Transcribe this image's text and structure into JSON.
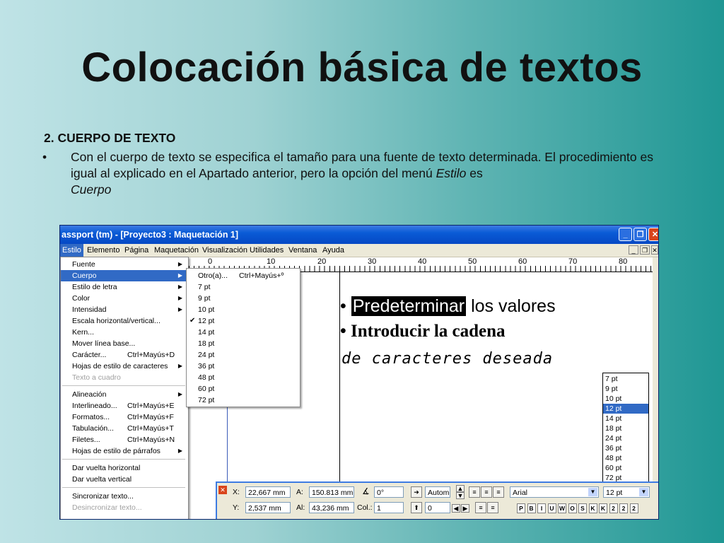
{
  "slide": {
    "title": "Colocación básica de textos",
    "heading": "2. CUERPO DE TEXTO",
    "bullet_char": "•",
    "bullet_text": "Con el cuerpo de texto se especifica el tamaño para una fuente de texto determinada. El procedimiento es igual al explicado en el Apartado anterior, pero la opción del menú ",
    "bullet_italic1": "Estilo",
    "bullet_mid": " es ",
    "bullet_italic2": "Cuerpo"
  },
  "window": {
    "title": "assport (tm) - [Proyecto3 : Maquetación 1]",
    "menu": [
      "Estilo",
      "Elemento",
      "Página",
      "Maquetación",
      "Visualización",
      "Utilidades",
      "Ventana",
      "Ayuda"
    ],
    "active_menu": "Estilo"
  },
  "ruler": {
    "labels": [
      "0",
      "10",
      "20",
      "30",
      "40",
      "50",
      "60",
      "70",
      "80"
    ]
  },
  "style_menu": {
    "items": [
      {
        "label": "Fuente",
        "shortcut": "",
        "sub": true
      },
      {
        "label": "Cuerpo",
        "shortcut": "",
        "sub": true,
        "selected": true
      },
      {
        "label": "Estilo de letra",
        "shortcut": "",
        "sub": true
      },
      {
        "label": "Color",
        "shortcut": "",
        "sub": true
      },
      {
        "label": "Intensidad",
        "shortcut": "",
        "sub": true
      },
      {
        "label": "Escala horizontal/vertical...",
        "shortcut": ""
      },
      {
        "label": "Kern...",
        "shortcut": ""
      },
      {
        "label": "Mover línea base...",
        "shortcut": ""
      },
      {
        "label": "Carácter...",
        "shortcut": "Ctrl+Mayús+D"
      },
      {
        "label": "Hojas de estilo de caracteres",
        "shortcut": "",
        "sub": true
      },
      {
        "label": "Texto a cuadro",
        "shortcut": "",
        "disabled": true
      },
      {
        "sep": true
      },
      {
        "label": "Alineación",
        "shortcut": "",
        "sub": true
      },
      {
        "label": "Interlineado...",
        "shortcut": "Ctrl+Mayús+E"
      },
      {
        "label": "Formatos...",
        "shortcut": "Ctrl+Mayús+F"
      },
      {
        "label": "Tabulación...",
        "shortcut": "Ctrl+Mayús+T"
      },
      {
        "label": "Filetes...",
        "shortcut": "Ctrl+Mayús+N"
      },
      {
        "label": "Hojas de estilo de párrafos",
        "shortcut": "",
        "sub": true
      },
      {
        "sep": true
      },
      {
        "label": "Dar vuelta horizontal",
        "shortcut": ""
      },
      {
        "label": "Dar vuelta vertical",
        "shortcut": ""
      },
      {
        "sep": true
      },
      {
        "label": "Sincronizar texto...",
        "shortcut": ""
      },
      {
        "label": "Desincronizar texto...",
        "shortcut": "",
        "disabled": true
      }
    ]
  },
  "size_menu": {
    "items": [
      {
        "label": "Otro(a)...",
        "shortcut": "Ctrl+Mayús+º"
      },
      {
        "label": "7 pt"
      },
      {
        "label": "9 pt"
      },
      {
        "label": "10 pt"
      },
      {
        "label": "12 pt",
        "checked": true
      },
      {
        "label": "14 pt"
      },
      {
        "label": "18 pt"
      },
      {
        "label": "24 pt"
      },
      {
        "label": "36 pt"
      },
      {
        "label": "48 pt"
      },
      {
        "label": "60 pt"
      },
      {
        "label": "72 pt"
      }
    ],
    "check_mark": "✔"
  },
  "canvas": {
    "bullet": "•",
    "line1_highlight": "Predeterminar",
    "line1_rest": " los valores",
    "line2": "Introducir la cadena",
    "line3": "de caracteres deseada"
  },
  "size_list": {
    "options": [
      "7 pt",
      "9 pt",
      "10 pt",
      "12 pt",
      "14 pt",
      "18 pt",
      "24 pt",
      "36 pt",
      "48 pt",
      "60 pt",
      "72 pt"
    ],
    "selected": "12 pt"
  },
  "palette": {
    "x_label": "X:",
    "x_value": "22,667 mm",
    "y_label": "Y:",
    "y_value": "2,537 mm",
    "a_label": "A:",
    "a_value": "150.813 mm",
    "al_label": "Al:",
    "al_value": "43,236 mm",
    "angle_value": "0°",
    "col_label": "Col.:",
    "col_value": "1",
    "leading_value": "Autom",
    "tracking_value": "0",
    "font_value": "Arial",
    "size_value": "12 pt",
    "style_buttons": [
      "P",
      "B",
      "I",
      "U",
      "W",
      "O",
      "S",
      "K",
      "K",
      "2",
      "2",
      "2"
    ]
  },
  "colors": {
    "accent": "#316ac5",
    "titlebar": "#0a5bd6"
  }
}
